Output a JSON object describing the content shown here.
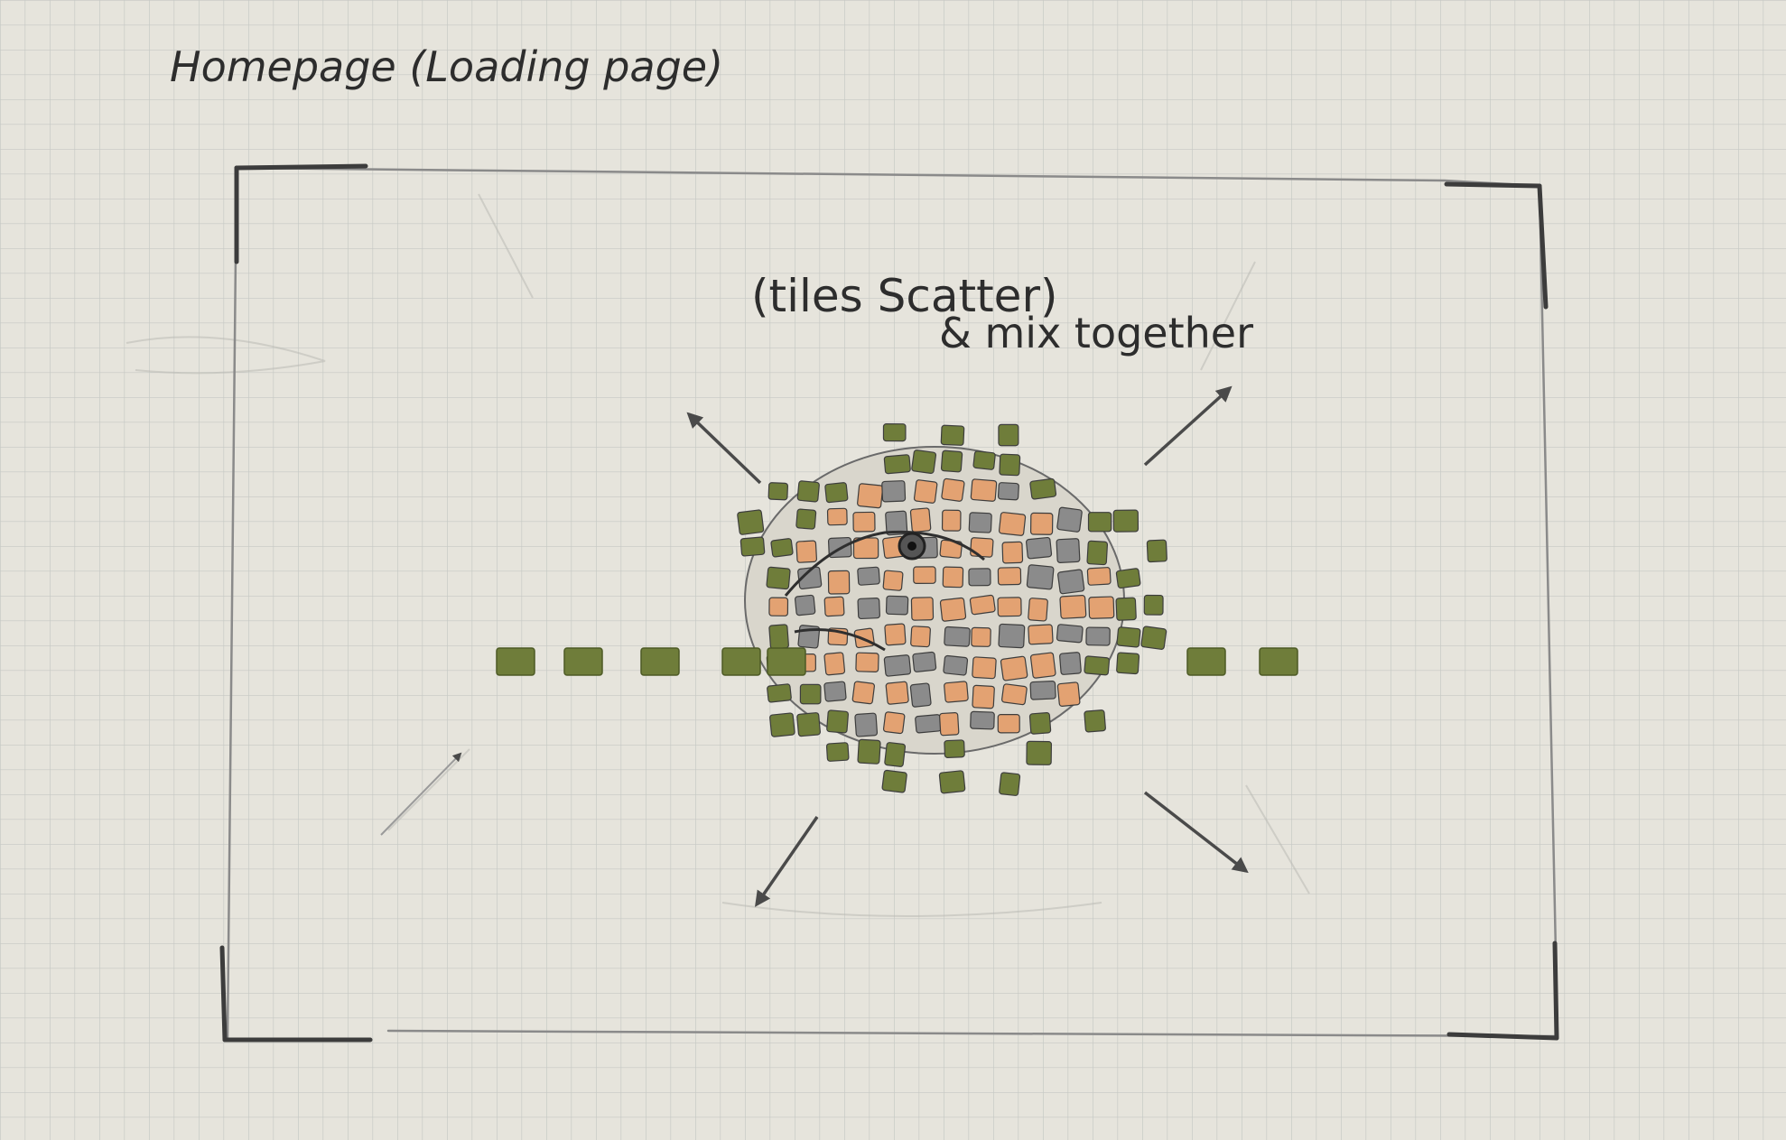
{
  "page_title": "Homepage (Loading page)",
  "annotation": {
    "line1": "(tiles Scatter)",
    "line2": "& mix together"
  },
  "colors": {
    "paper": "#e6e4dc",
    "grid": "#c5c8c4",
    "pencil": "#555555",
    "tile_green": "#6f7d3a",
    "tile_orange": "#e3a272",
    "tile_gray": "#8b8b8b"
  },
  "sketch": {
    "subject": "mosaic tile lizard/iguana head",
    "motion": "scatter-outward",
    "arrow_directions": [
      "up-left",
      "up-right",
      "down-left",
      "down-right"
    ]
  }
}
